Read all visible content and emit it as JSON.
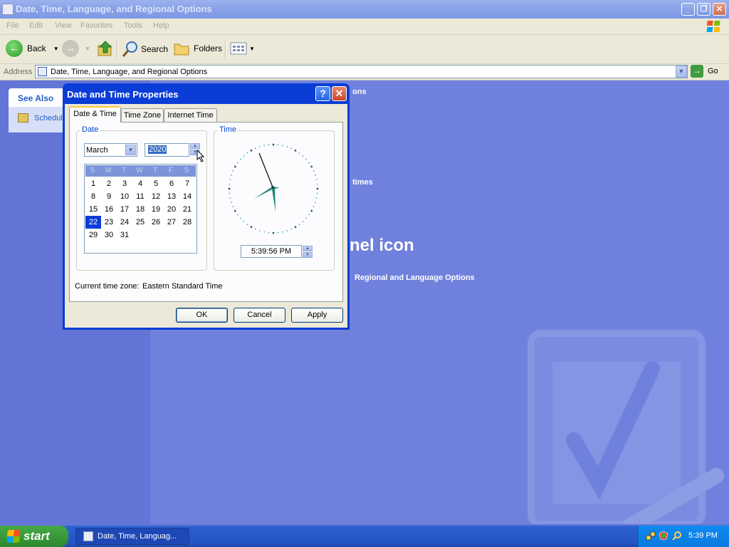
{
  "window": {
    "title": "Date, Time, Language, and Regional Options"
  },
  "menu": [
    "File",
    "Edit",
    "View",
    "Favorites",
    "Tools",
    "Help"
  ],
  "toolbar": {
    "back": "Back",
    "search": "Search",
    "folders": "Folders"
  },
  "address": {
    "label": "Address",
    "value": "Date, Time, Language, and Regional Options",
    "go": "Go"
  },
  "see_also": {
    "title": "See Also",
    "item": "Schedule"
  },
  "background_text": {
    "line1": "ons",
    "line2": "times",
    "line3": "nel icon",
    "line4": "Regional and Language Options"
  },
  "dialog": {
    "title": "Date and Time Properties",
    "help": "?",
    "close": "✕",
    "tabs": [
      "Date & Time",
      "Time Zone",
      "Internet Time"
    ],
    "date_group": "Date",
    "time_group": "Time",
    "month": "March",
    "year": "2020",
    "weekdays": [
      "S",
      "M",
      "T",
      "W",
      "T",
      "F",
      "S"
    ],
    "days": [
      [
        "",
        "1",
        "2",
        "3",
        "4",
        "5",
        "6",
        "7"
      ],
      [
        "8",
        "9",
        "10",
        "11",
        "12",
        "13",
        "14"
      ],
      [
        "15",
        "16",
        "17",
        "18",
        "19",
        "20",
        "21"
      ],
      [
        "22",
        "23",
        "24",
        "25",
        "26",
        "27",
        "28"
      ],
      [
        "29",
        "30",
        "31"
      ]
    ],
    "selected_day": "22",
    "time": "5:39:56 PM",
    "timezone_label": "Current time zone:",
    "timezone_value": "Eastern Standard Time",
    "buttons": {
      "ok": "OK",
      "cancel": "Cancel",
      "apply": "Apply"
    }
  },
  "taskbar": {
    "start": "start",
    "task": "Date, Time, Languag...",
    "clock": "5:39 PM"
  }
}
